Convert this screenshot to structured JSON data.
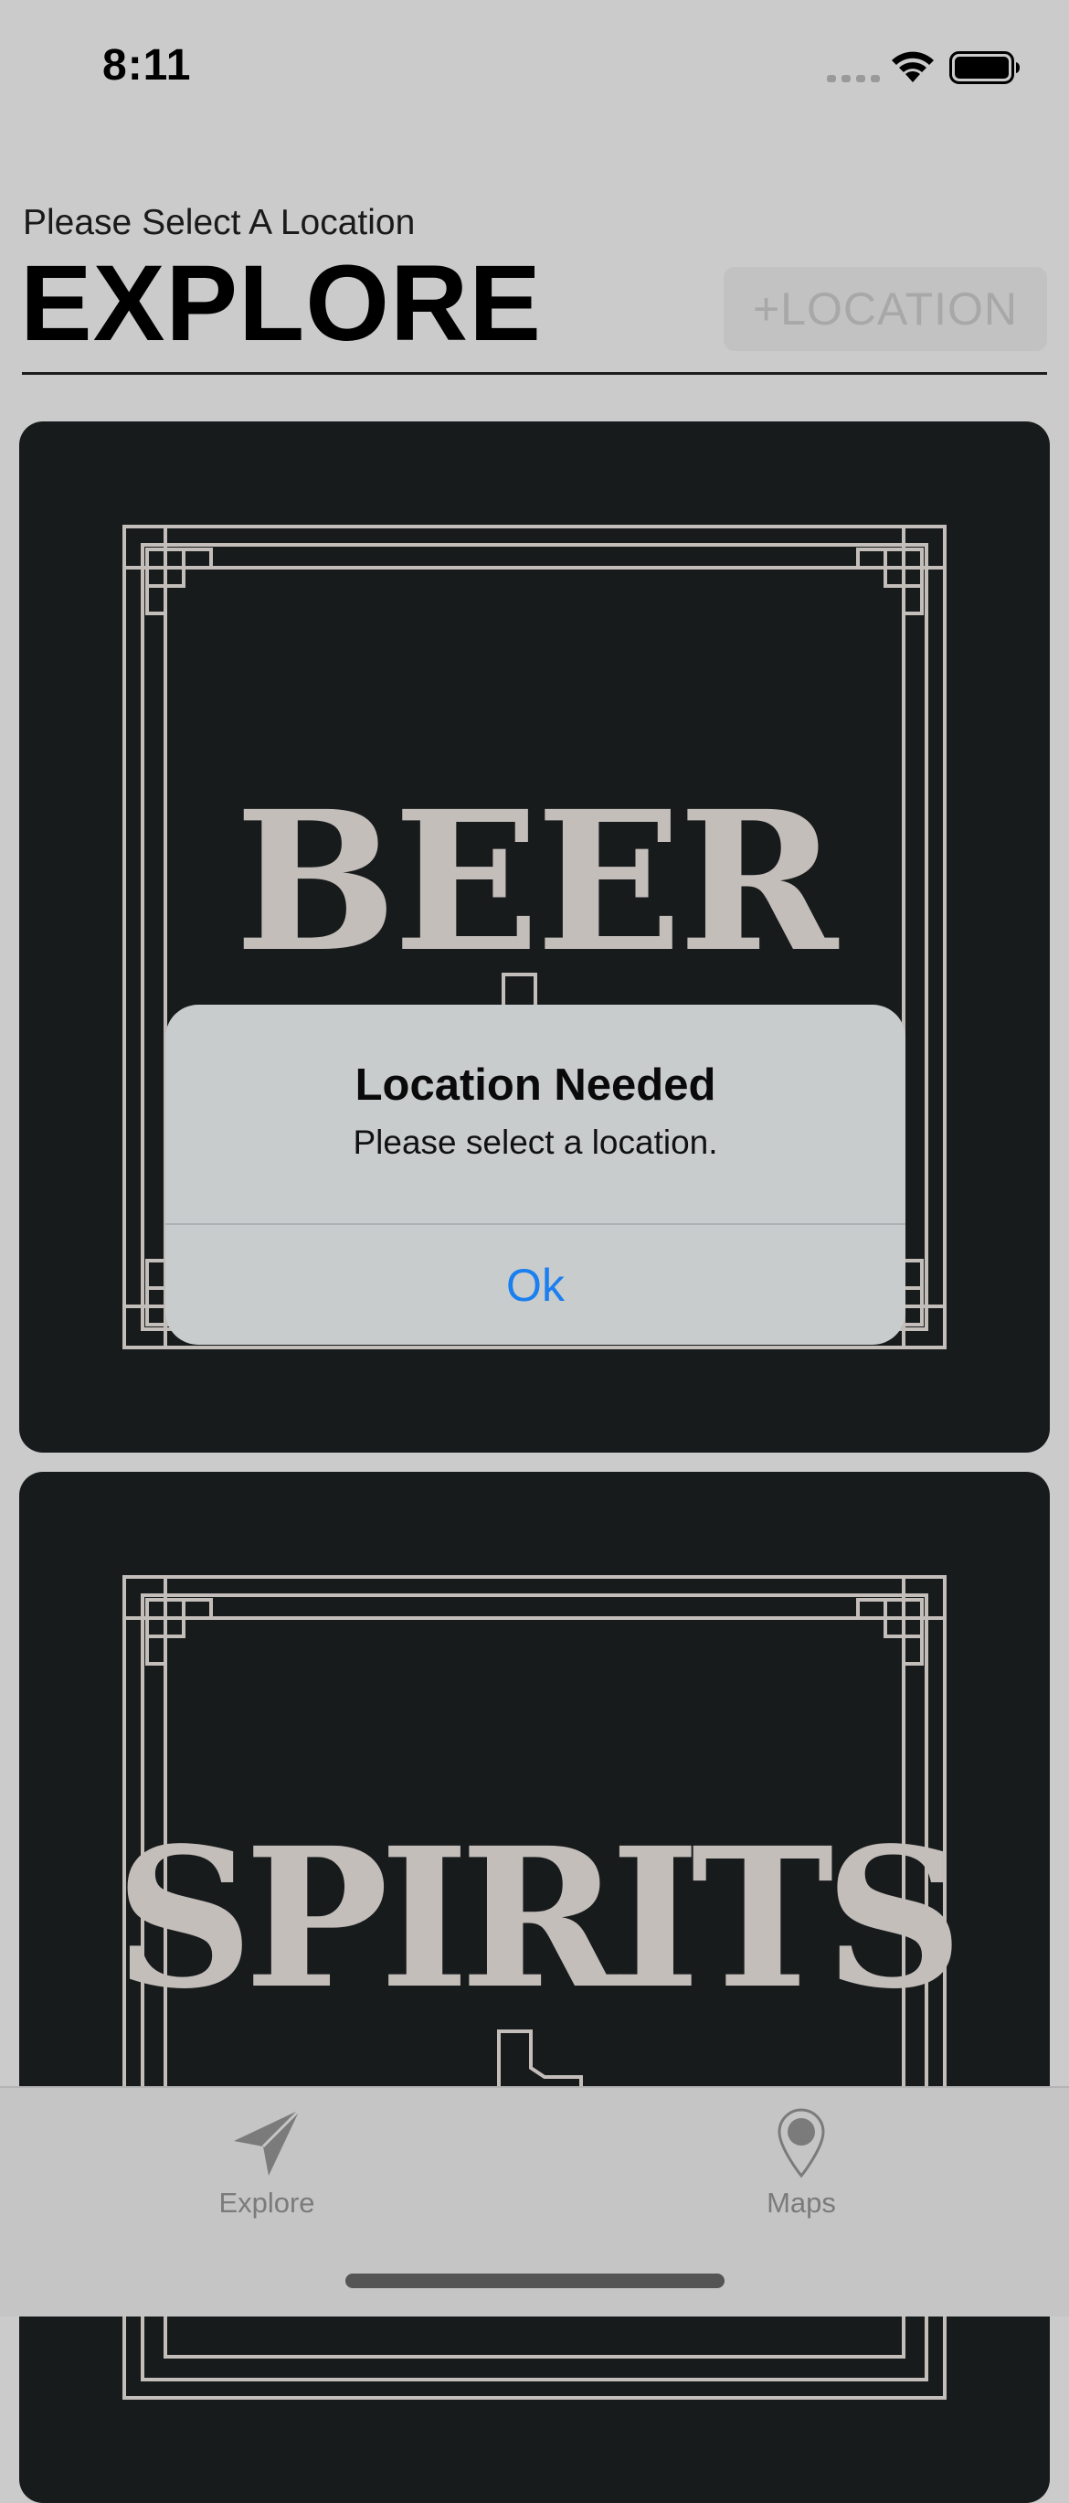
{
  "status_bar": {
    "time": "8:11"
  },
  "header": {
    "subtitle": "Please Select A Location",
    "title": "EXPLORE",
    "add_location_label": "+LOCATION"
  },
  "cards": [
    {
      "label": "BEER"
    },
    {
      "label": "SPIRITS"
    }
  ],
  "alert": {
    "title": "Location Needed",
    "message": "Please select a location.",
    "ok_label": "Ok"
  },
  "tab_bar": {
    "items": [
      {
        "label": "Explore",
        "icon": "paper-plane-icon"
      },
      {
        "label": "Maps",
        "icon": "map-pin-icon"
      }
    ]
  },
  "colors": {
    "background": "#cbcbcb",
    "card": "#181b1c",
    "card_text": "#c4bebb",
    "alert_button": "#1a7ff0"
  }
}
